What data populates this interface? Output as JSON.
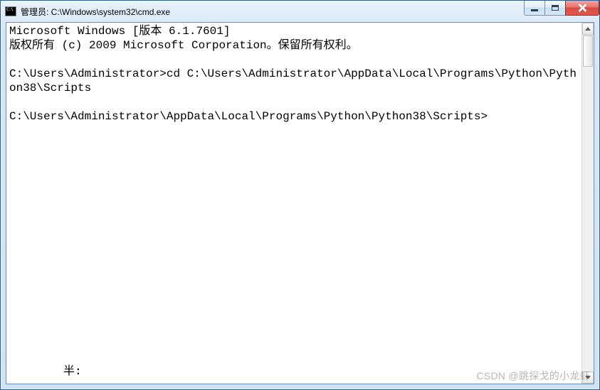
{
  "window": {
    "title": "管理员: C:\\Windows\\system32\\cmd.exe"
  },
  "console": {
    "lines": [
      "Microsoft Windows [版本 6.1.7601]",
      "版权所有 (c) 2009 Microsoft Corporation。保留所有权利。",
      "",
      "C:\\Users\\Administrator>cd C:\\Users\\Administrator\\AppData\\Local\\Programs\\Python\\Python38\\Scripts",
      "",
      "C:\\Users\\Administrator\\AppData\\Local\\Programs\\Python\\Python38\\Scripts>"
    ]
  },
  "footer": {
    "partial": "半:"
  },
  "watermark": "CSDN @跳探戈的小龙虾"
}
